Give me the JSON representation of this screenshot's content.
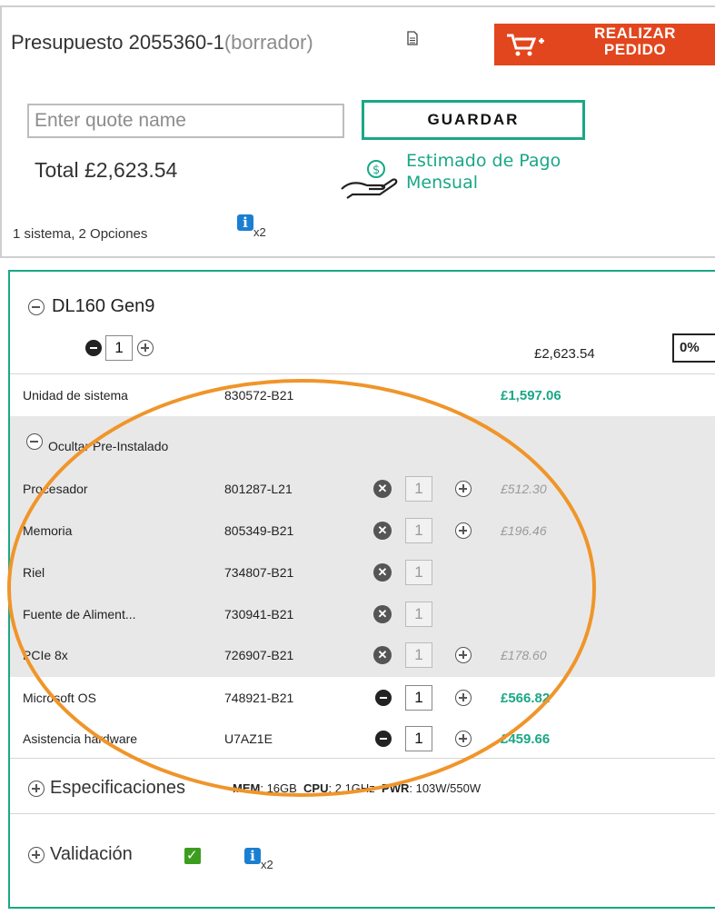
{
  "quote": {
    "title": "Presupuesto 2055360-1",
    "status": "(borrador)",
    "order_button": "REALIZAR PEDIDO",
    "name_placeholder": "Enter quote name",
    "save_button": "GUARDAR",
    "total": "Total £2,623.54",
    "monthly_link": "Estimado de Pago Mensual",
    "summary": "1 sistema, 2 Opciones",
    "info_count": "x2"
  },
  "config": {
    "model": "DL160 Gen9",
    "quantity": "1",
    "price": "£2,623.54",
    "discount": "0%",
    "system_unit": {
      "label": "Unidad de sistema",
      "sku": "830572-B21",
      "price": "£1,597.06"
    },
    "preinstalled_toggle": "Ocultar Pre-Instalado",
    "preinstalled": [
      {
        "label": "Procesador",
        "sku": "801287-L21",
        "qty": "1",
        "price": "£512.30"
      },
      {
        "label": "Memoria",
        "sku": "805349-B21",
        "qty": "1",
        "price": "£196.46"
      },
      {
        "label": "Riel",
        "sku": "734807-B21",
        "qty": "1",
        "price": ""
      },
      {
        "label": "Fuente de Aliment...",
        "sku": "730941-B21",
        "qty": "1",
        "price": ""
      },
      {
        "label": "PCIe 8x",
        "sku": "726907-B21",
        "qty": "1",
        "price": "£178.60"
      }
    ],
    "options": [
      {
        "label": "Microsoft OS",
        "sku": "748921-B21",
        "qty": "1",
        "price": "£566.82"
      },
      {
        "label": "Asistencia hardware",
        "sku": "U7AZ1E",
        "qty": "1",
        "price": "£459.66"
      }
    ],
    "specs": {
      "label": "Especificaciones",
      "mem_key": "MEM",
      "mem_val": ": 16GB",
      "cpu_key": "CPU",
      "cpu_val": ": 2.1GHz",
      "pwr_key": "PWR",
      "pwr_val": ": 103W/550W"
    },
    "validation": {
      "label": "Validación",
      "info_count": "x2"
    }
  },
  "colors": {
    "accent": "#1aa787",
    "order": "#e2461e",
    "annotation": "#f0952a",
    "info": "#1a7fd1"
  },
  "icons": [
    "document-icon",
    "cart-plus-icon",
    "hand-coin-icon",
    "info-icon",
    "minus-circle-icon",
    "plus-circle-icon",
    "remove-x-icon",
    "check-icon"
  ]
}
